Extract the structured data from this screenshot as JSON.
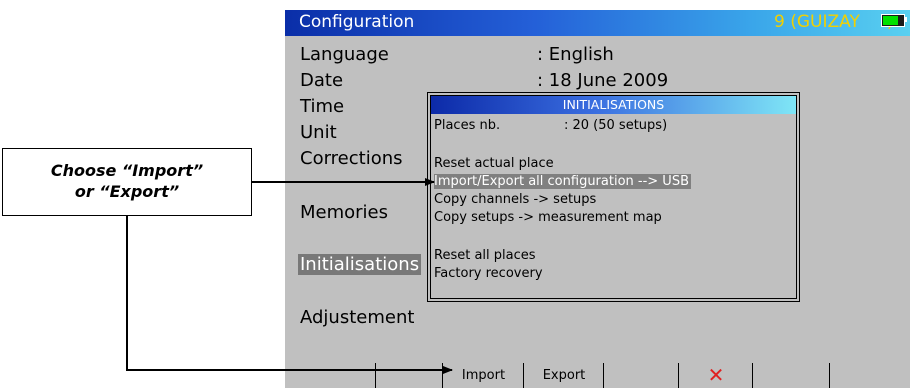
{
  "window": {
    "title": "Configuration",
    "channel_info": "9 (GUIZAY     )",
    "battery_level": 0.75,
    "battery_color": "#00e000"
  },
  "settings": {
    "language_label": "Language",
    "language_value": ": English",
    "date_label": "Date",
    "date_value": ": 18 June 2009",
    "time_label": "Time",
    "unit_label": "Unit",
    "corrections_label": "Corrections",
    "memories_label": "Memories",
    "initialisations_label": "Initialisations",
    "adjustement_label": "Adjustement"
  },
  "popup": {
    "title": "INITIALISATIONS",
    "places_label": "Places nb.",
    "places_value": ": 20 (50 setups)",
    "items": [
      "Reset actual place",
      "Import/Export all configuration --> USB",
      "Copy channels -> setups",
      "Copy setups -> measurement map",
      "Reset all places",
      "Factory recovery"
    ],
    "selected_index": 1
  },
  "softkeys": {
    "keys": [
      "",
      "",
      "Import",
      "Export",
      "",
      "",
      "",
      ""
    ],
    "cancel_icon": "cancel-x-icon",
    "cancel_color": "#e02020"
  },
  "callout": {
    "line1": "Choose “Import”",
    "line2": "or “Export”"
  }
}
